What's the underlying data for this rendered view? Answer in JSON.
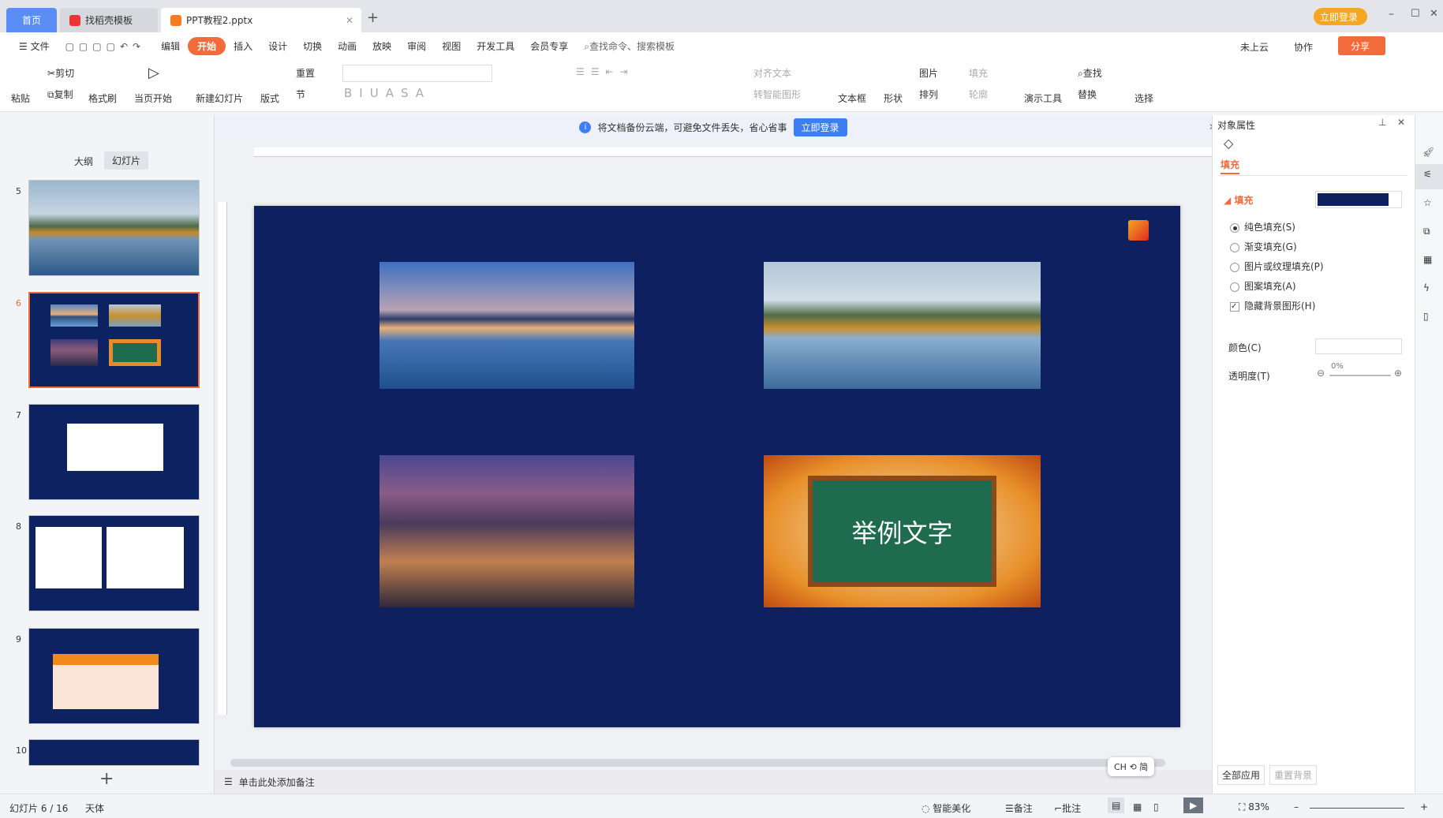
{
  "tabs": [
    {
      "label": "首页"
    },
    {
      "label": "找稻壳模板"
    },
    {
      "label": "PPT教程2.pptx"
    }
  ],
  "window": {
    "login_label": "立即登录",
    "new_tab": "+"
  },
  "menu": {
    "file": "文件",
    "edit": "编辑",
    "items": [
      "开始",
      "插入",
      "设计",
      "切换",
      "动画",
      "放映",
      "审阅",
      "视图",
      "开发工具",
      "会员专享"
    ],
    "search_placeholder": "查找命令、搜索模板",
    "cloud": "未上云",
    "collab": "协作",
    "share": "分享"
  },
  "ribbon": {
    "paste": "粘贴",
    "cut": "剪切",
    "copy": "复制",
    "format_painter": "格式刷",
    "play_from_current": "当页开始",
    "new_slide": "新建幻灯片",
    "layout": "版式",
    "reset": "重置",
    "section": "节",
    "align_text": "对齐文本",
    "smart_art": "转智能图形",
    "textbox": "文本框",
    "shape": "形状",
    "picture": "图片",
    "arrange": "排列",
    "fill": "填充",
    "outline": "轮廓",
    "present_tools": "演示工具",
    "find": "查找",
    "replace": "替换",
    "select": "选择"
  },
  "notice": {
    "text": "将文档备份云端，可避免文件丢失，省心省事",
    "button": "立即登录"
  },
  "left_panel": {
    "tabs": [
      "大纲",
      "幻灯片"
    ],
    "slides": [
      5,
      6,
      7,
      8,
      9,
      10
    ],
    "selected": 6
  },
  "slide": {
    "caption": "举例文字",
    "background": "#0f2060"
  },
  "right_panel": {
    "title": "对象属性",
    "tab": "填充",
    "section": "填充",
    "fill_color": "#0d1f5c",
    "options": [
      {
        "label": "纯色填充(S)",
        "checked": true
      },
      {
        "label": "渐变填充(G)",
        "checked": false
      },
      {
        "label": "图片或纹理填充(P)",
        "checked": false
      },
      {
        "label": "图案填充(A)",
        "checked": false
      }
    ],
    "hide_bg": {
      "label": "隐藏背景图形(H)",
      "checked": true
    },
    "color_label": "颜色(C)",
    "transparency_label": "透明度(T)",
    "transparency_value": "0%",
    "apply_all": "全部应用",
    "reset_bg": "重置背景"
  },
  "notes": {
    "placeholder": "单击此处添加备注"
  },
  "ime": "CH ⟲ 简",
  "status": {
    "slide_info": "幻灯片 6 / 16",
    "theme": "天体",
    "smart": "智能美化",
    "notes": "备注",
    "comment": "批注",
    "zoom": "83%"
  },
  "colors": {
    "accent": "#f26b3a",
    "blue": "#3d7ef5"
  }
}
